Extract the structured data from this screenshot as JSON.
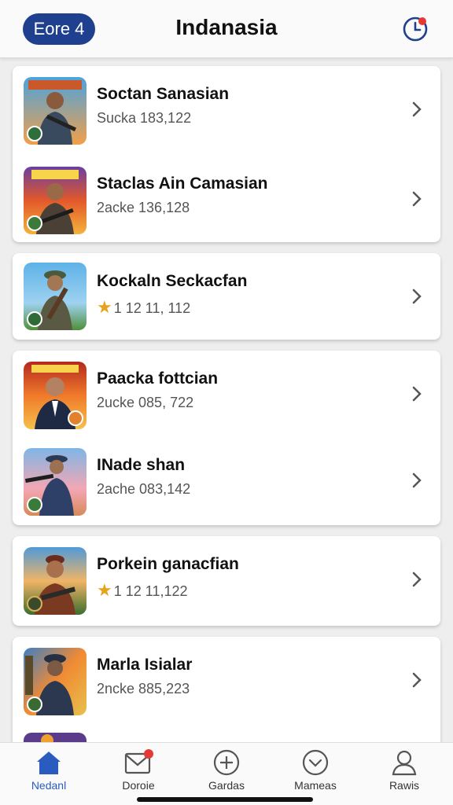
{
  "header": {
    "pill_label": "Eore 4",
    "title": "Indanasia",
    "notification_dot_color": "#e53935",
    "accent": "#1f3f8f"
  },
  "list": [
    {
      "name": "Soctan Sanasian",
      "sub": "Sucka 183,122",
      "rating": false,
      "thumb": "soldier-blue-sky"
    },
    {
      "name": "Staclas Ain Camasian",
      "sub": "2acke 136,128",
      "rating": false,
      "thumb": "soldier-fire"
    },
    {
      "name": "Kockaln Seckacfan",
      "sub": "1 12 11, 112",
      "rating": true,
      "thumb": "soldier-field"
    },
    {
      "name": "Paacka fottcian",
      "sub": "2ucke 085, 722",
      "rating": false,
      "thumb": "agent-explosion"
    },
    {
      "name": "INade shan",
      "sub": "2ache 083,142",
      "rating": false,
      "thumb": "soldier-sunset"
    },
    {
      "name": "Porkein ganacfian",
      "sub": "1 12 11,122",
      "rating": true,
      "thumb": "soldier-jungle"
    },
    {
      "name": "Marla Isialar",
      "sub": "2ncke 885,223",
      "rating": false,
      "thumb": "soldier-blast"
    }
  ],
  "bottom_nav": [
    {
      "label": "Nedanl",
      "icon": "home-icon",
      "active": true
    },
    {
      "label": "Doroie",
      "icon": "mail-icon",
      "active": false,
      "badge": true
    },
    {
      "label": "Gardas",
      "icon": "plus-circle-icon",
      "active": false
    },
    {
      "label": "Mameas",
      "icon": "download-circle-icon",
      "active": false
    },
    {
      "label": "Rawis",
      "icon": "user-icon",
      "active": false
    }
  ],
  "colors": {
    "background": "#eeeeee",
    "card": "#ffffff",
    "active_nav": "#2a5bbf",
    "star": "#e7a31b"
  }
}
